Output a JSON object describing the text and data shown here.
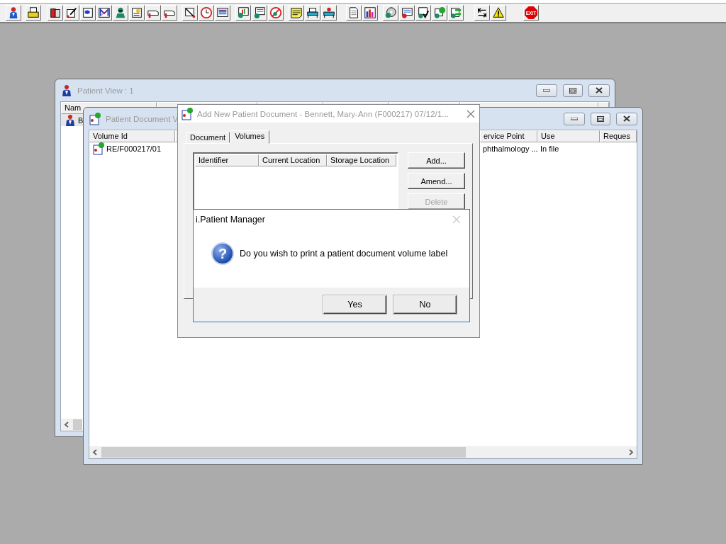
{
  "toolbar": {
    "exit_label": "EXIT"
  },
  "patient_view": {
    "title": "Patient View : 1",
    "columns": [
      "Nam",
      "",
      "",
      "",
      "",
      "",
      ""
    ],
    "rows": [
      {
        "cells": [
          "B"
        ],
        "selected": true
      }
    ]
  },
  "document_window": {
    "title": "Patient Document V",
    "columns": [
      "Volume Id",
      "",
      "ervice Point",
      "Use",
      "Reques"
    ],
    "rows": [
      {
        "cells": [
          "RE/F000217/01",
          "",
          "phthalmology ...",
          "In file",
          ""
        ],
        "selected": false
      }
    ]
  },
  "add_dialog": {
    "title": "Add New Patient Document - Bennett, Mary-Ann (F000217) 07/12/1...",
    "tabs": [
      {
        "label": "Document",
        "selected": false
      },
      {
        "label": "Volumes",
        "selected": true
      }
    ],
    "columns": [
      "Identifier",
      "Current Location",
      "Storage Location"
    ],
    "buttons": [
      {
        "label": "Add...",
        "disabled": false
      },
      {
        "label": "Amend...",
        "disabled": false
      },
      {
        "label": "Delete",
        "disabled": true
      }
    ]
  },
  "message_box": {
    "title": "i.Patient Manager",
    "icon_label": "?",
    "message": "Do you wish to print a patient document volume label",
    "buttons": [
      "Yes",
      "No"
    ]
  }
}
